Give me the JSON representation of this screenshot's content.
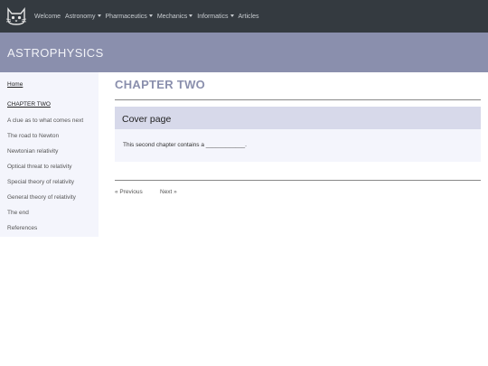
{
  "navbar": {
    "items": [
      {
        "label": "Welcome"
      },
      {
        "label": "Astronomy"
      },
      {
        "label": "Pharmaceutics"
      },
      {
        "label": "Mechanics"
      },
      {
        "label": "Informatics"
      },
      {
        "label": "Articles"
      }
    ],
    "logo_icon": "cat-icon"
  },
  "banner": {
    "title": "ASTROPHYSICS"
  },
  "sidebar": {
    "items": [
      {
        "label": "Home"
      },
      {
        "label": "CHAPTER TWO"
      },
      {
        "label": "A clue as to what comes next"
      },
      {
        "label": "The road to Newton"
      },
      {
        "label": "Newtonian relativity"
      },
      {
        "label": "Optical threat to relativity"
      },
      {
        "label": "Special theory of relativity"
      },
      {
        "label": "General theory of relativity"
      },
      {
        "label": "The end"
      },
      {
        "label": "References"
      }
    ]
  },
  "main": {
    "title": "CHAPTER TWO",
    "card": {
      "heading": "Cover page",
      "text": "This second chapter contains a ____________."
    },
    "pager": {
      "previous": "« Previous",
      "next": "Next »"
    }
  },
  "colors": {
    "navbar": "#343a40",
    "banner": "#8a8fad",
    "accent": "#8a8fad",
    "sidebar_bg": "#f4f5fc",
    "card_header_bg": "#d7d9ea"
  }
}
